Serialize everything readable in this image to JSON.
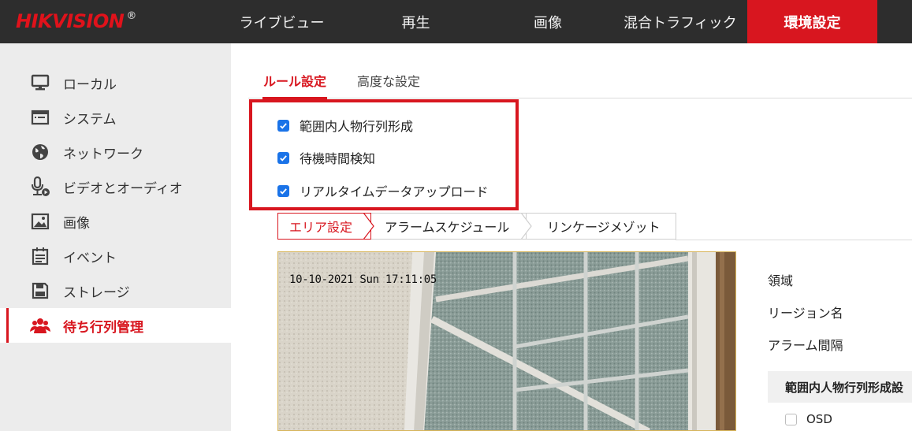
{
  "header": {
    "logo": "HIKVISION",
    "logo_mark": "®",
    "nav": [
      {
        "label": "ライブビュー"
      },
      {
        "label": "再生"
      },
      {
        "label": "画像"
      },
      {
        "label": "混合トラフィック"
      },
      {
        "label": "環境設定"
      }
    ],
    "active_nav": "環境設定"
  },
  "sidebar": {
    "items": [
      {
        "label": "ローカル",
        "icon": "monitor-icon"
      },
      {
        "label": "システム",
        "icon": "window-icon"
      },
      {
        "label": "ネットワーク",
        "icon": "globe-icon"
      },
      {
        "label": "ビデオとオーディオ",
        "icon": "microphone-icon"
      },
      {
        "label": "画像",
        "icon": "image-icon"
      },
      {
        "label": "イベント",
        "icon": "calendar-icon"
      },
      {
        "label": "ストレージ",
        "icon": "save-icon"
      },
      {
        "label": "待ち行列管理",
        "icon": "users-icon"
      }
    ],
    "active_item": "待ち行列管理"
  },
  "main": {
    "tabs": [
      {
        "label": "ルール設定"
      },
      {
        "label": "高度な設定"
      }
    ],
    "options": [
      {
        "label": "範囲内人物行列形成",
        "checked": true
      },
      {
        "label": "待機時間検知",
        "checked": true
      },
      {
        "label": "リアルタイムデータアップロード",
        "checked": true
      }
    ],
    "subtabs": [
      {
        "label": "エリア設定"
      },
      {
        "label": "アラームスケジュール"
      },
      {
        "label": "リンケージメゾット"
      }
    ],
    "video": {
      "osd_text": "10-10-2021 Sun 17:11:05"
    },
    "form": {
      "region_label": "領域",
      "region_name_label": "リージョン名",
      "alarm_interval_label": "アラーム間隔",
      "section_title": "範囲内人物行列形成設",
      "osd_label": "OSD",
      "osd_checked": false
    }
  },
  "colors": {
    "accent": "#d8161f",
    "topbar": "#2d2d2d",
    "sidebar": "#ececec",
    "checkbox": "#1a73e8"
  }
}
